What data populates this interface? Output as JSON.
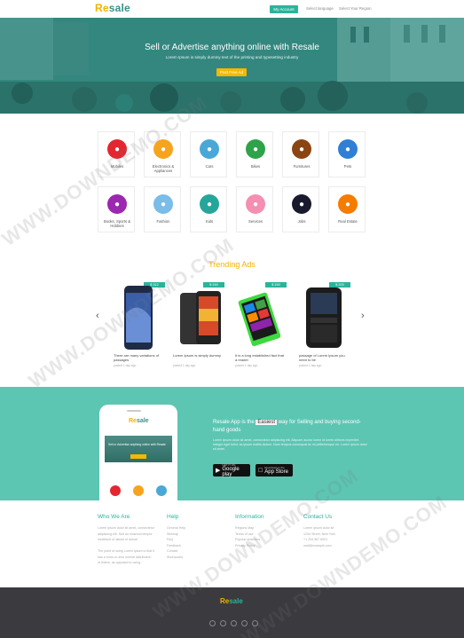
{
  "header": {
    "logo_re": "Re",
    "logo_sale": "sale",
    "account_label": "My Account",
    "select_language": "Select language",
    "select_region": "Select Your Region"
  },
  "hero": {
    "title": "Sell or Advertise anything online with Resale",
    "subtitle": "Lorem Ipsum is simply dummy text of the printing and typesetting industry",
    "button_label": "Post Free Ad"
  },
  "categories": [
    {
      "label": "Mobiles",
      "color": "#e3262f",
      "icon": "mobile-icon"
    },
    {
      "label": "Electronics & Appliances",
      "color": "#f7a41d",
      "icon": "electronics-icon"
    },
    {
      "label": "Cars",
      "color": "#4aa8d8",
      "icon": "car-icon"
    },
    {
      "label": "Bikes",
      "color": "#2ea34a",
      "icon": "bike-icon"
    },
    {
      "label": "Furnitures",
      "color": "#8b4513",
      "icon": "furniture-icon"
    },
    {
      "label": "Pets",
      "color": "#2f7fd6",
      "icon": "pet-icon"
    },
    {
      "label": "Books, Sports & Hobbies",
      "color": "#9c27b0",
      "icon": "book-icon"
    },
    {
      "label": "Fashion",
      "color": "#79bde8",
      "icon": "fashion-icon"
    },
    {
      "label": "Kids",
      "color": "#26a69a",
      "icon": "kids-icon"
    },
    {
      "label": "Services",
      "color": "#f48fb1",
      "icon": "services-icon"
    },
    {
      "label": "Jobs",
      "color": "#1a1a2e",
      "icon": "jobs-icon"
    },
    {
      "label": "Real Estate",
      "color": "#f57c00",
      "icon": "real-estate-icon"
    }
  ],
  "trending": {
    "title": "Trending Ads",
    "ads": [
      {
        "price": "$ 312",
        "desc": "There are many variations of passages",
        "meta": "posted 1 day ago"
      },
      {
        "price": "$ 150",
        "desc": "Lorem Ipsum is simply dummy",
        "meta": "posted 1 day ago"
      },
      {
        "price": "$ 150",
        "desc": "It is a long established fact that a reader",
        "meta": "posted 1 day ago"
      },
      {
        "price": "$ 200",
        "desc": "passage of Lorem Ipsum you need to be",
        "meta": "posted 1 day ago"
      }
    ]
  },
  "app_band": {
    "title_pre": "Resale App is the",
    "title_highlight": "Easiest",
    "title_post": "way for Selling and buying second-hand goods",
    "body": "Lorem ipsum dolor sit amet, consectetur adipiscing elit. Aliquam auctor lorem id lorem ultrices imperdiet. Integer eget tortor ac ipsum mattis dictum. Nam tempus consequat ac mi pellentesque eu. Lorem ipsum dolor sit amet.",
    "google_small": "GET IT ON",
    "google_big": "Google play",
    "apple_small": "Download on the",
    "apple_big": "App Store",
    "phone_logo_re": "Re",
    "phone_logo_sale": "sale",
    "phone_hero_text": "Sell or Advertise anything online with Resale"
  },
  "footer": {
    "who_title": "Who We Are",
    "who_lines": [
      "Lorem ipsum dolor sit amet, consectetur",
      "adipiscing elit. Sed do eiusmod tempor",
      "incididunt ut labore et dolore",
      "",
      "The point of using Lorem Ipsum is that it",
      "has a more-or-less normal distribution",
      "of letters, as opposed to using."
    ],
    "help_title": "Help",
    "help_lines": [
      "General Help",
      "Sitemap",
      "FAQ",
      "Feedback",
      "Contact",
      "Shortcodes"
    ],
    "info_title": "Information",
    "info_lines": [
      "Regions Map",
      "Terms of use",
      "Popular searches",
      "Privacy Policy"
    ],
    "contact_title": "Contact Us",
    "contact_lines": [
      "Lorem ipsum dolor sit",
      "1234 Street, New York",
      "+1 234 567 8901",
      "mail@example.com"
    ],
    "bottom_logo_re": "Re",
    "bottom_logo_sale": "sale"
  },
  "watermark": "WWW.DOWNDEMO.COM"
}
